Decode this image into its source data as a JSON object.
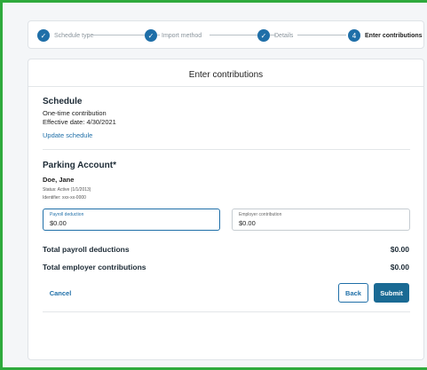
{
  "stepper": {
    "steps": [
      {
        "label": "Schedule type",
        "status": "complete"
      },
      {
        "label": "Import method",
        "status": "complete"
      },
      {
        "label": "Details",
        "status": "complete"
      },
      {
        "label": "Enter contributions",
        "status": "current",
        "number": "4"
      }
    ],
    "check_glyph": "✓"
  },
  "main": {
    "title": "Enter contributions",
    "schedule": {
      "heading": "Schedule",
      "type": "One-time contribution",
      "effective_date": "Effective date: 4/30/2021",
      "update_link": "Update schedule"
    },
    "account": {
      "heading": "Parking Account*",
      "name": "Doe, Jane",
      "status": "Status: Active (1/1/2013)",
      "identifier": "Identifier: xxx-xx-0000",
      "payroll_field": {
        "label": "Payroll deduction",
        "value": "$0.00"
      },
      "employer_field": {
        "label": "Employer contribution",
        "value": "$0.00"
      }
    },
    "totals": {
      "payroll_label": "Total payroll deductions",
      "payroll_value": "$0.00",
      "employer_label": "Total employer contributions",
      "employer_value": "$0.00"
    },
    "actions": {
      "cancel": "Cancel",
      "back": "Back",
      "submit": "Submit"
    }
  },
  "colors": {
    "accent": "#1f6fa8",
    "primary_button": "#1a6a94",
    "frame_border": "#2eaa3c"
  }
}
